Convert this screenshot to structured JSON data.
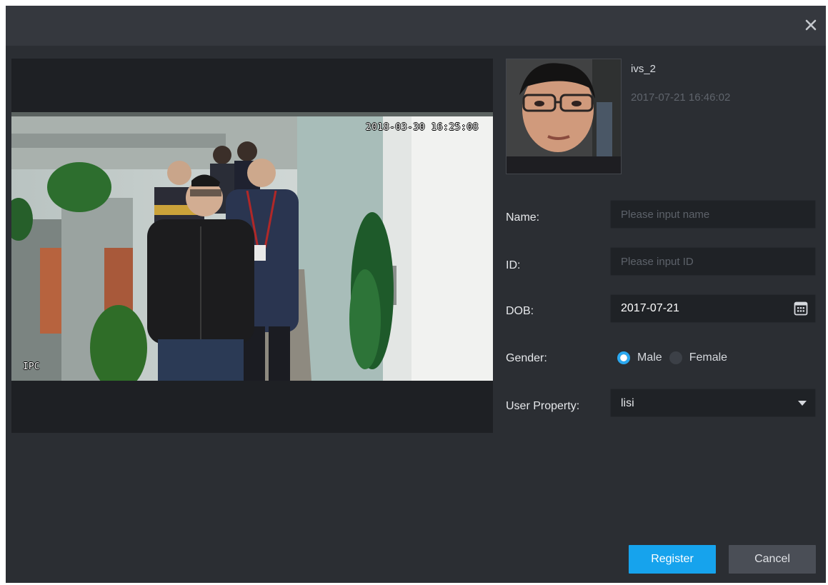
{
  "dialog": {
    "close_label": "close"
  },
  "snapshot": {
    "osd_timestamp": "2018-03-30 16:25:08",
    "osd_camera": "IPC",
    "source_name": "ivs_2",
    "capture_time": "2017-07-21 16:46:02"
  },
  "form": {
    "name_label": "Name:",
    "name_placeholder": "Please input name",
    "name_value": "",
    "id_label": "ID:",
    "id_placeholder": "Please input ID",
    "id_value": "",
    "dob_label": "DOB:",
    "dob_value": "2017-07-21",
    "gender_label": "Gender:",
    "gender_options": [
      "Male",
      "Female"
    ],
    "gender_selected": "Male",
    "property_label": "User Property:",
    "property_value": "lisi"
  },
  "actions": {
    "register_label": "Register",
    "cancel_label": "Cancel"
  },
  "colors": {
    "accent": "#16a3ed",
    "dialog_bg": "#2b2e33",
    "titlebar_bg": "#35383e"
  },
  "icons": {
    "close": "close-icon",
    "calendar": "calendar-icon",
    "dropdown": "chevron-down-icon"
  }
}
